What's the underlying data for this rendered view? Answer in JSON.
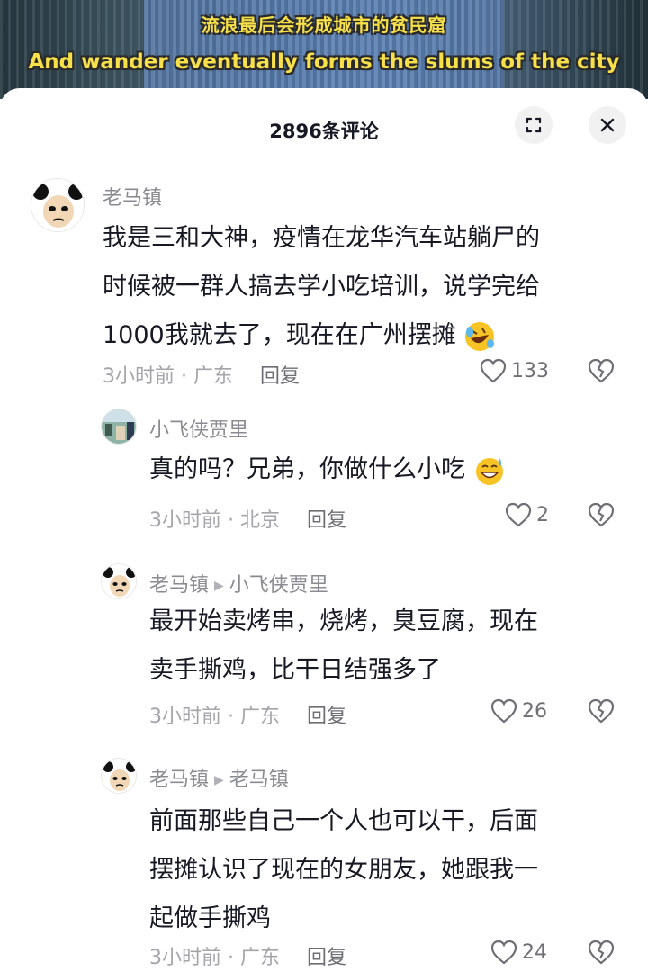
{
  "video": {
    "subtitle_cn": "流浪最后会形成城市的贫民窟",
    "subtitle_en": "And wander eventually forms the slums of the city"
  },
  "sheet": {
    "title": "2896条评论"
  },
  "comments": [
    {
      "author": "老马镇",
      "lines": [
        "我是三和大神，疫情在龙华汽车站躺尸的",
        "时候被一群人搞去学小吃培训，说学完给",
        "1000我就去了，现在在广州摆摊"
      ],
      "emoji": "rofl",
      "time": "3小时前",
      "location": "广东",
      "reply_label": "回复",
      "likes": "133"
    },
    {
      "author": "小飞侠贾里",
      "lines": [
        "真的吗？兄弟，你做什么小吃"
      ],
      "emoji": "sweat-smile",
      "time": "3小时前",
      "location": "北京",
      "reply_label": "回复",
      "likes": "2"
    },
    {
      "author": "老马镇",
      "reply_to": "小飞侠贾里",
      "lines": [
        "最开始卖烤串，烧烤，臭豆腐，现在",
        "卖手撕鸡，比干日结强多了"
      ],
      "time": "3小时前",
      "location": "广东",
      "reply_label": "回复",
      "likes": "26"
    },
    {
      "author": "老马镇",
      "reply_to": "老马镇",
      "lines": [
        "前面那些自己一个人也可以干，后面",
        "摆摊认识了现在的女朋友，她跟我一",
        "起做手撕鸡"
      ],
      "time": "3小时前",
      "location": "广东",
      "reply_label": "回复",
      "likes": "24"
    }
  ],
  "meta_separator": " · "
}
